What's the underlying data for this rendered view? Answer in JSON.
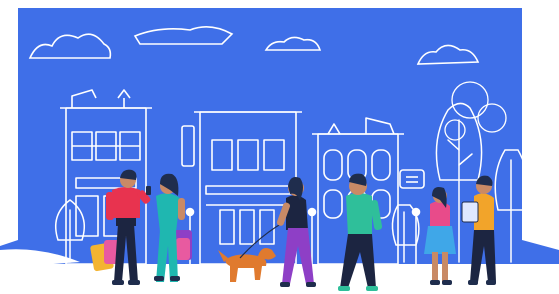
{
  "scene": {
    "colors": {
      "sky": "#3f6fe8",
      "outline": "#ffffff",
      "ground": "#ffffff",
      "skin": "#c98a66",
      "hair": "#1f2d4d",
      "dog": "#e07a2e",
      "shirt_red": "#e8334f",
      "shirt_teal": "#1fb7b0",
      "shirt_green": "#2fbf9a",
      "shirt_orange": "#f2a42a",
      "dress_purple": "#8e3fc6",
      "dress_pink": "#e84b8a",
      "pants_dark": "#1c2541",
      "bag_pink": "#e85aa0",
      "bag_yellow": "#f3b431",
      "skirt_blue": "#3fa7e8"
    },
    "elements": {
      "clouds": [
        "cloud",
        "cloud",
        "cloud",
        "cloud"
      ],
      "buildings": [
        "building-left",
        "building-center",
        "building-right"
      ],
      "trees": [
        "tree",
        "tree",
        "tree",
        "tree"
      ],
      "people": [
        "man-with-shopping-bags",
        "woman-with-bags",
        "woman-walking-dog",
        "man-in-green-shirt",
        "woman-in-pink",
        "man-with-tablet"
      ],
      "animals": [
        "dog"
      ]
    }
  }
}
